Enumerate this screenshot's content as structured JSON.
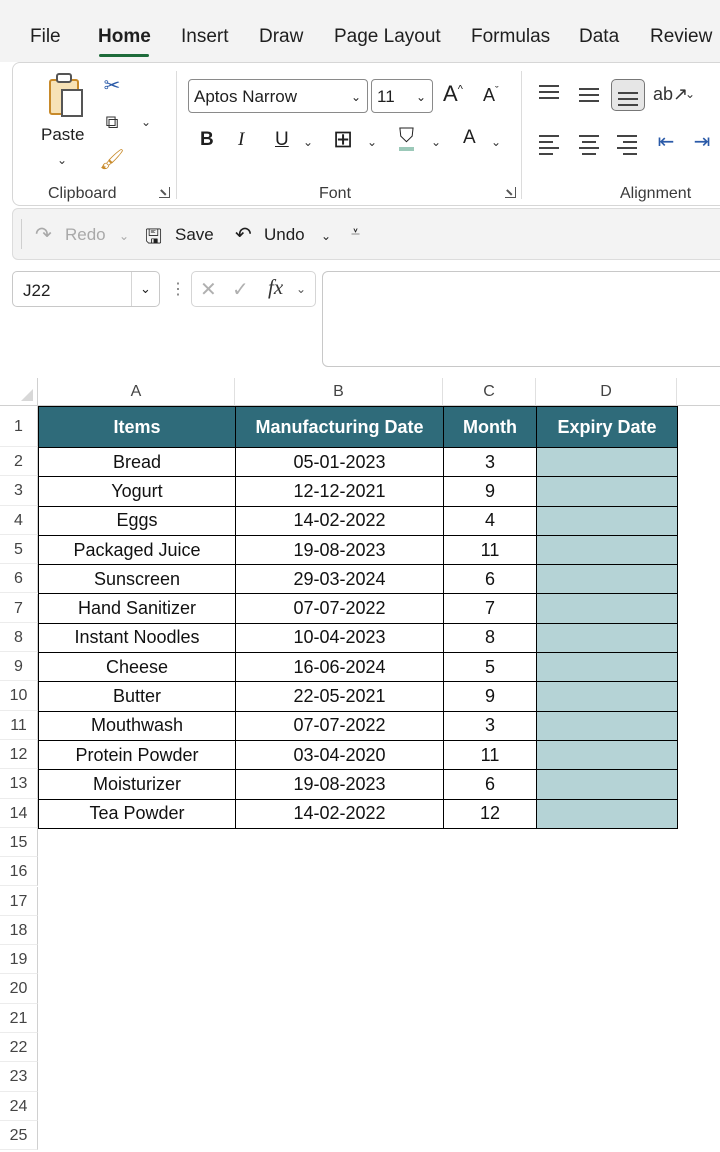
{
  "tabs": [
    "File",
    "Home",
    "Insert",
    "Draw",
    "Page Layout",
    "Formulas",
    "Data",
    "Review"
  ],
  "active_tab": "Home",
  "ribbon": {
    "clipboard": {
      "paste_label": "Paste",
      "group_label": "Clipboard"
    },
    "font": {
      "font_name": "Aptos Narrow",
      "font_size": "11",
      "bold": "B",
      "italic": "I",
      "underline": "U",
      "grow": "A",
      "shrink": "A",
      "font_color": "A",
      "group_label": "Font"
    },
    "alignment": {
      "group_label": "Alignment"
    }
  },
  "quick_access": {
    "redo_label": "Redo",
    "save_label": "Save",
    "undo_label": "Undo"
  },
  "formula_bar": {
    "name_box": "J22",
    "formula": "",
    "fx": "fx"
  },
  "columns": [
    "A",
    "B",
    "C",
    "D"
  ],
  "rows": [
    "1",
    "2",
    "3",
    "4",
    "5",
    "6",
    "7",
    "8",
    "9",
    "10",
    "11",
    "12",
    "13",
    "14",
    "15",
    "16",
    "17",
    "18",
    "19",
    "20",
    "21",
    "22",
    "23",
    "24",
    "25"
  ],
  "table": {
    "headers": [
      "Items",
      "Manufacturing Date",
      "Month",
      "Expiry Date"
    ],
    "header_color": "#2f6b7a",
    "expiry_fill_color": "#b5d3d6",
    "rows": [
      [
        "Bread",
        "05-01-2023",
        "3",
        ""
      ],
      [
        "Yogurt",
        "12-12-2021",
        "9",
        ""
      ],
      [
        "Eggs",
        "14-02-2022",
        "4",
        ""
      ],
      [
        "Packaged Juice",
        "19-08-2023",
        "11",
        ""
      ],
      [
        "Sunscreen",
        "29-03-2024",
        "6",
        ""
      ],
      [
        "Hand Sanitizer",
        "07-07-2022",
        "7",
        ""
      ],
      [
        "Instant Noodles",
        "10-04-2023",
        "8",
        ""
      ],
      [
        "Cheese",
        "16-06-2024",
        "5",
        ""
      ],
      [
        "Butter",
        "22-05-2021",
        "9",
        ""
      ],
      [
        "Mouthwash",
        "07-07-2022",
        "3",
        ""
      ],
      [
        "Protein Powder",
        "03-04-2020",
        "11",
        ""
      ],
      [
        "Moisturizer",
        "19-08-2023",
        "6",
        ""
      ],
      [
        "Tea Powder",
        "14-02-2022",
        "12",
        ""
      ]
    ]
  }
}
